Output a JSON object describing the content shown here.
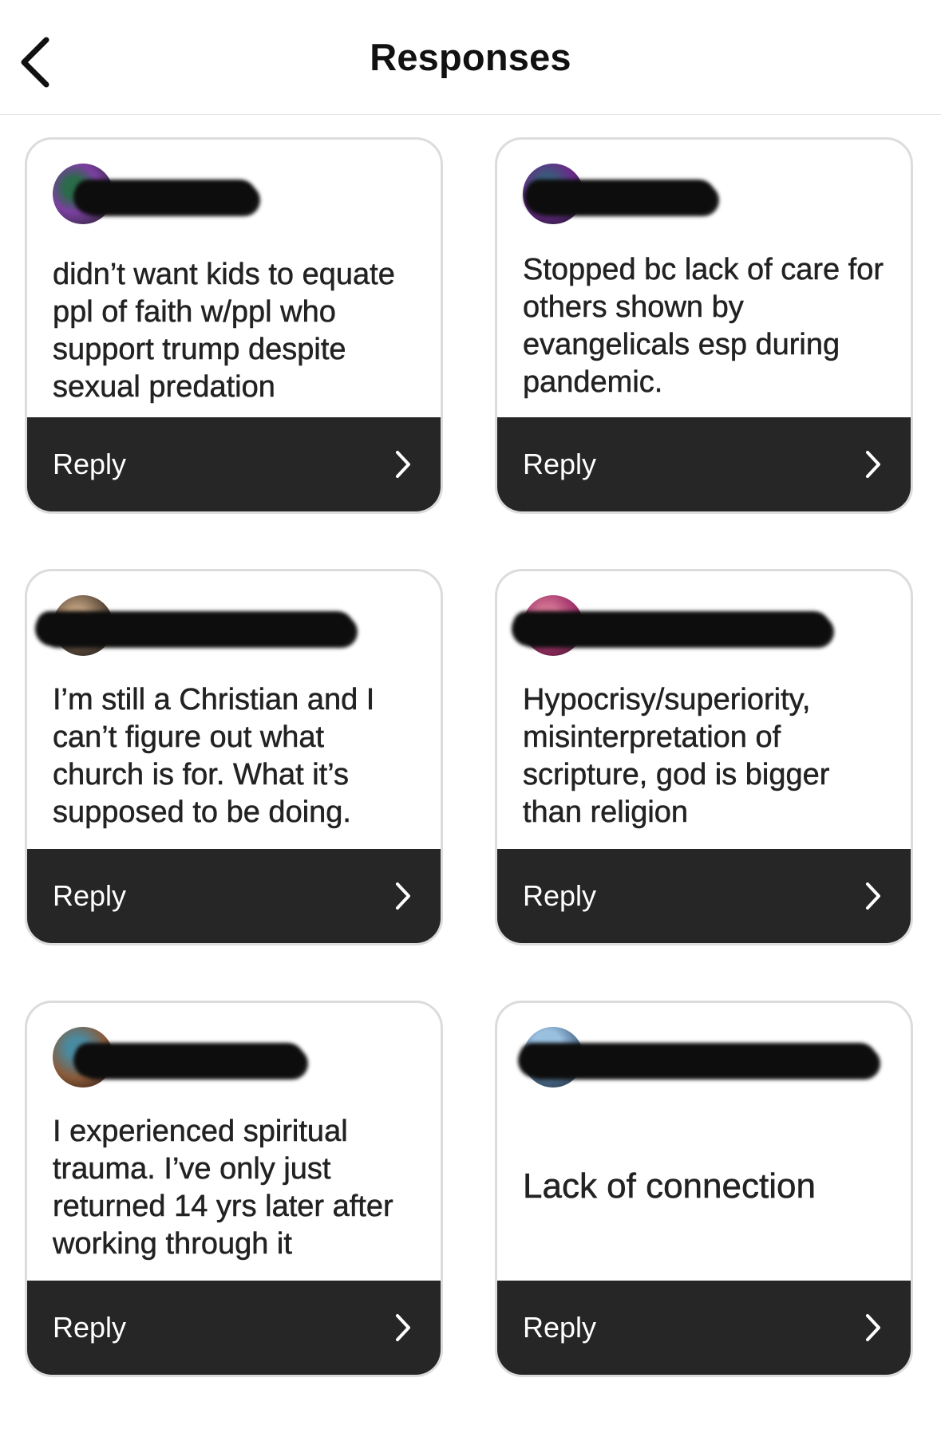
{
  "header": {
    "title": "Responses",
    "back_icon": "chevron-left-icon"
  },
  "cards": [
    {
      "message": "didn’t want kids to equate ppl of faith w/ppl who support trump despite sexual predation",
      "reply_label": "Reply",
      "avatar_color": "#7b3fa0"
    },
    {
      "message": "Stopped bc lack of care for others shown by evangelicals esp during pandemic.",
      "reply_label": "Reply",
      "avatar_color": "#6a2a8a"
    },
    {
      "message": "I’m still a Christian and I can’t figure out what church is for. What it’s supposed to be doing.",
      "reply_label": "Reply",
      "avatar_color": "#5c4a3a"
    },
    {
      "message": "Hypocrisy/superiority, misinterpretation of scripture, god is bigger than religion",
      "reply_label": "Reply",
      "avatar_color": "#a0306a"
    },
    {
      "message": "I experienced spiritual trauma. I’ve only just returned 14 yrs later after working through it",
      "reply_label": "Reply",
      "avatar_color": "#8a5a3a"
    },
    {
      "message": "Lack of connection",
      "reply_label": "Reply",
      "avatar_color": "#4a6a8a"
    }
  ]
}
